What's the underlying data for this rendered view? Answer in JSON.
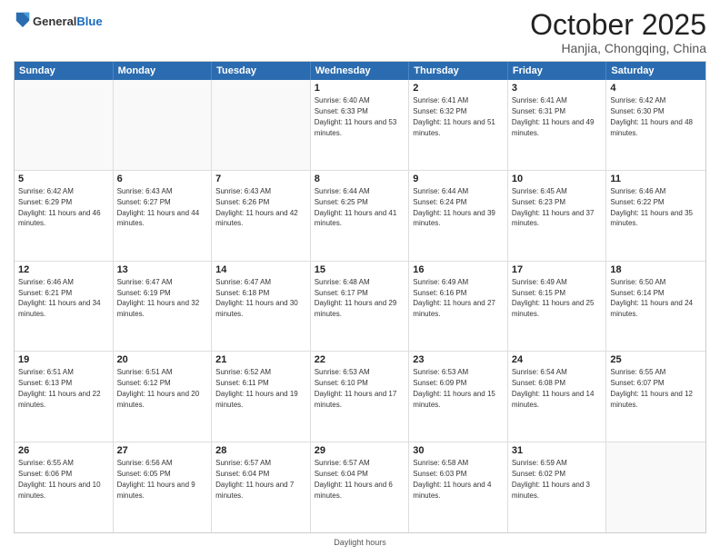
{
  "header": {
    "logo_general": "General",
    "logo_blue": "Blue",
    "month": "October 2025",
    "location": "Hanjia, Chongqing, China"
  },
  "days_of_week": [
    "Sunday",
    "Monday",
    "Tuesday",
    "Wednesday",
    "Thursday",
    "Friday",
    "Saturday"
  ],
  "footer_text": "Daylight hours",
  "weeks": [
    [
      {
        "day": "",
        "sunrise": "",
        "sunset": "",
        "daylight": ""
      },
      {
        "day": "",
        "sunrise": "",
        "sunset": "",
        "daylight": ""
      },
      {
        "day": "",
        "sunrise": "",
        "sunset": "",
        "daylight": ""
      },
      {
        "day": "1",
        "sunrise": "Sunrise: 6:40 AM",
        "sunset": "Sunset: 6:33 PM",
        "daylight": "Daylight: 11 hours and 53 minutes."
      },
      {
        "day": "2",
        "sunrise": "Sunrise: 6:41 AM",
        "sunset": "Sunset: 6:32 PM",
        "daylight": "Daylight: 11 hours and 51 minutes."
      },
      {
        "day": "3",
        "sunrise": "Sunrise: 6:41 AM",
        "sunset": "Sunset: 6:31 PM",
        "daylight": "Daylight: 11 hours and 49 minutes."
      },
      {
        "day": "4",
        "sunrise": "Sunrise: 6:42 AM",
        "sunset": "Sunset: 6:30 PM",
        "daylight": "Daylight: 11 hours and 48 minutes."
      }
    ],
    [
      {
        "day": "5",
        "sunrise": "Sunrise: 6:42 AM",
        "sunset": "Sunset: 6:29 PM",
        "daylight": "Daylight: 11 hours and 46 minutes."
      },
      {
        "day": "6",
        "sunrise": "Sunrise: 6:43 AM",
        "sunset": "Sunset: 6:27 PM",
        "daylight": "Daylight: 11 hours and 44 minutes."
      },
      {
        "day": "7",
        "sunrise": "Sunrise: 6:43 AM",
        "sunset": "Sunset: 6:26 PM",
        "daylight": "Daylight: 11 hours and 42 minutes."
      },
      {
        "day": "8",
        "sunrise": "Sunrise: 6:44 AM",
        "sunset": "Sunset: 6:25 PM",
        "daylight": "Daylight: 11 hours and 41 minutes."
      },
      {
        "day": "9",
        "sunrise": "Sunrise: 6:44 AM",
        "sunset": "Sunset: 6:24 PM",
        "daylight": "Daylight: 11 hours and 39 minutes."
      },
      {
        "day": "10",
        "sunrise": "Sunrise: 6:45 AM",
        "sunset": "Sunset: 6:23 PM",
        "daylight": "Daylight: 11 hours and 37 minutes."
      },
      {
        "day": "11",
        "sunrise": "Sunrise: 6:46 AM",
        "sunset": "Sunset: 6:22 PM",
        "daylight": "Daylight: 11 hours and 35 minutes."
      }
    ],
    [
      {
        "day": "12",
        "sunrise": "Sunrise: 6:46 AM",
        "sunset": "Sunset: 6:21 PM",
        "daylight": "Daylight: 11 hours and 34 minutes."
      },
      {
        "day": "13",
        "sunrise": "Sunrise: 6:47 AM",
        "sunset": "Sunset: 6:19 PM",
        "daylight": "Daylight: 11 hours and 32 minutes."
      },
      {
        "day": "14",
        "sunrise": "Sunrise: 6:47 AM",
        "sunset": "Sunset: 6:18 PM",
        "daylight": "Daylight: 11 hours and 30 minutes."
      },
      {
        "day": "15",
        "sunrise": "Sunrise: 6:48 AM",
        "sunset": "Sunset: 6:17 PM",
        "daylight": "Daylight: 11 hours and 29 minutes."
      },
      {
        "day": "16",
        "sunrise": "Sunrise: 6:49 AM",
        "sunset": "Sunset: 6:16 PM",
        "daylight": "Daylight: 11 hours and 27 minutes."
      },
      {
        "day": "17",
        "sunrise": "Sunrise: 6:49 AM",
        "sunset": "Sunset: 6:15 PM",
        "daylight": "Daylight: 11 hours and 25 minutes."
      },
      {
        "day": "18",
        "sunrise": "Sunrise: 6:50 AM",
        "sunset": "Sunset: 6:14 PM",
        "daylight": "Daylight: 11 hours and 24 minutes."
      }
    ],
    [
      {
        "day": "19",
        "sunrise": "Sunrise: 6:51 AM",
        "sunset": "Sunset: 6:13 PM",
        "daylight": "Daylight: 11 hours and 22 minutes."
      },
      {
        "day": "20",
        "sunrise": "Sunrise: 6:51 AM",
        "sunset": "Sunset: 6:12 PM",
        "daylight": "Daylight: 11 hours and 20 minutes."
      },
      {
        "day": "21",
        "sunrise": "Sunrise: 6:52 AM",
        "sunset": "Sunset: 6:11 PM",
        "daylight": "Daylight: 11 hours and 19 minutes."
      },
      {
        "day": "22",
        "sunrise": "Sunrise: 6:53 AM",
        "sunset": "Sunset: 6:10 PM",
        "daylight": "Daylight: 11 hours and 17 minutes."
      },
      {
        "day": "23",
        "sunrise": "Sunrise: 6:53 AM",
        "sunset": "Sunset: 6:09 PM",
        "daylight": "Daylight: 11 hours and 15 minutes."
      },
      {
        "day": "24",
        "sunrise": "Sunrise: 6:54 AM",
        "sunset": "Sunset: 6:08 PM",
        "daylight": "Daylight: 11 hours and 14 minutes."
      },
      {
        "day": "25",
        "sunrise": "Sunrise: 6:55 AM",
        "sunset": "Sunset: 6:07 PM",
        "daylight": "Daylight: 11 hours and 12 minutes."
      }
    ],
    [
      {
        "day": "26",
        "sunrise": "Sunrise: 6:55 AM",
        "sunset": "Sunset: 6:06 PM",
        "daylight": "Daylight: 11 hours and 10 minutes."
      },
      {
        "day": "27",
        "sunrise": "Sunrise: 6:56 AM",
        "sunset": "Sunset: 6:05 PM",
        "daylight": "Daylight: 11 hours and 9 minutes."
      },
      {
        "day": "28",
        "sunrise": "Sunrise: 6:57 AM",
        "sunset": "Sunset: 6:04 PM",
        "daylight": "Daylight: 11 hours and 7 minutes."
      },
      {
        "day": "29",
        "sunrise": "Sunrise: 6:57 AM",
        "sunset": "Sunset: 6:04 PM",
        "daylight": "Daylight: 11 hours and 6 minutes."
      },
      {
        "day": "30",
        "sunrise": "Sunrise: 6:58 AM",
        "sunset": "Sunset: 6:03 PM",
        "daylight": "Daylight: 11 hours and 4 minutes."
      },
      {
        "day": "31",
        "sunrise": "Sunrise: 6:59 AM",
        "sunset": "Sunset: 6:02 PM",
        "daylight": "Daylight: 11 hours and 3 minutes."
      },
      {
        "day": "",
        "sunrise": "",
        "sunset": "",
        "daylight": ""
      }
    ]
  ]
}
